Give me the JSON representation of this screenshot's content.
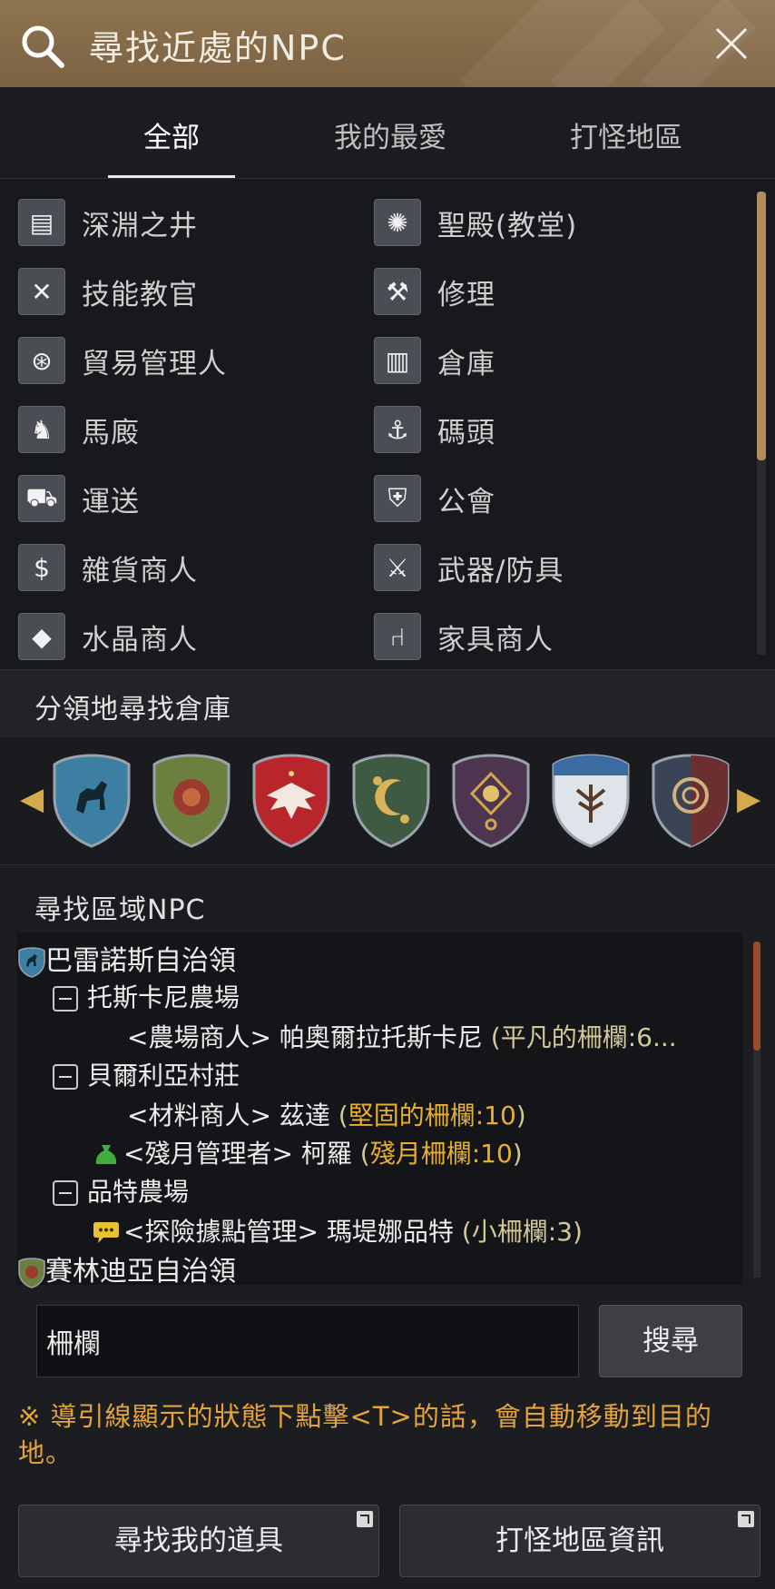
{
  "header": {
    "title": "尋找近處的NPC",
    "search_icon": "search-icon",
    "close_icon": "close-icon"
  },
  "tabs": [
    {
      "label": "全部",
      "active": true
    },
    {
      "label": "我的最愛",
      "active": false
    },
    {
      "label": "打怪地區",
      "active": false
    }
  ],
  "npc_categories": {
    "left": [
      {
        "label": "深淵之井",
        "icon": "well-icon"
      },
      {
        "label": "技能教官",
        "icon": "crossed-axes-icon"
      },
      {
        "label": "貿易管理人",
        "icon": "wheel-icon"
      },
      {
        "label": "馬廄",
        "icon": "horse-icon"
      },
      {
        "label": "運送",
        "icon": "wagon-icon"
      },
      {
        "label": "雜貨商人",
        "icon": "money-bag-icon"
      },
      {
        "label": "水晶商人",
        "icon": "crystal-icon"
      }
    ],
    "right": [
      {
        "label": "聖殿(教堂)",
        "icon": "temple-icon"
      },
      {
        "label": "修理",
        "icon": "anvil-icon"
      },
      {
        "label": "倉庫",
        "icon": "chest-icon"
      },
      {
        "label": "碼頭",
        "icon": "anchor-icon"
      },
      {
        "label": "公會",
        "icon": "guild-crest-icon"
      },
      {
        "label": "武器/防具",
        "icon": "weapon-armor-icon"
      },
      {
        "label": "家具商人",
        "icon": "chair-icon"
      }
    ]
  },
  "territory_section": {
    "title": "分領地尋找倉庫"
  },
  "territory_shields": [
    {
      "icon": "horse-shield-icon",
      "color": "#3d7fa3"
    },
    {
      "icon": "lion-shield-icon",
      "color": "#6b7f3e"
    },
    {
      "icon": "eagle-shield-icon",
      "color": "#b8262c"
    },
    {
      "icon": "moon-shield-icon",
      "color": "#3f5a42"
    },
    {
      "icon": "eye-shield-icon",
      "color": "#4d3550"
    },
    {
      "icon": "tree-shield-icon",
      "color": "#dfe4ea"
    },
    {
      "icon": "knot-shield-icon",
      "color": "#3a4456"
    }
  ],
  "area_section": {
    "title": "尋找區域NPC"
  },
  "tree": {
    "region_1": "巴雷諾斯自治領",
    "farm_1": "托斯卡尼農場",
    "npc_1": {
      "role": "<農場商人>",
      "name": "帕奧爾拉托斯卡尼",
      "detail": "(平凡的柵欄:6..."
    },
    "village_1": "貝爾利亞村莊",
    "npc_2": {
      "role": "<材料商人>",
      "name": "茲達",
      "open": "(",
      "detail": "堅固的柵欄:10",
      "close": ")"
    },
    "npc_3": {
      "role": "<殘月管理者>",
      "name": "柯羅",
      "open": "(",
      "detail": "殘月柵欄:10",
      "close": ")"
    },
    "farm_2": "品特農場",
    "npc_4": {
      "role": "<探險據點管理>",
      "name": "瑪堤娜品特",
      "detail": "(小柵欄:3)"
    },
    "region_2": "賽林迪亞自治領"
  },
  "search": {
    "value": "柵欄",
    "button_label": "搜尋"
  },
  "notice": "※ 導引線顯示的狀態下點擊<T>的話，會自動移動到目的地。",
  "buttons": {
    "find_items": "尋找我的道具",
    "monster_zone_info": "打怪地區資訊"
  }
}
